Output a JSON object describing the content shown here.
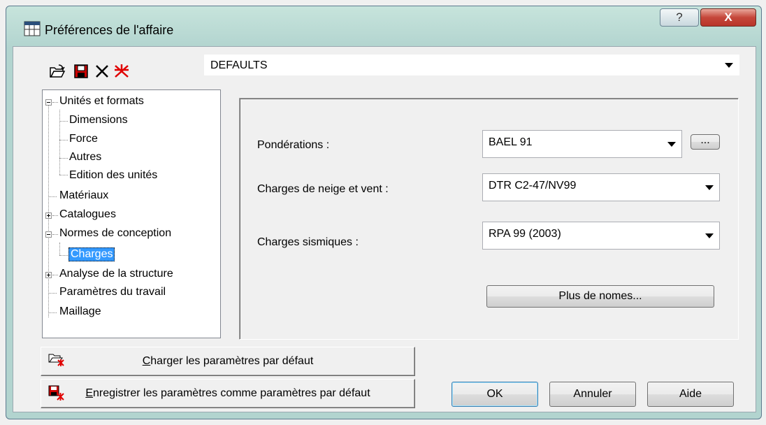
{
  "window": {
    "title": "Préférences de l'affaire",
    "help_glyph": "?",
    "close_glyph": "X"
  },
  "toolbar": {
    "icons": [
      "open-folder-icon",
      "save-icon",
      "delete-icon",
      "new-icon"
    ],
    "preset_value": "DEFAULTS"
  },
  "tree": {
    "units": "Unités et formats",
    "dimensions": "Dimensions",
    "force": "Force",
    "others": "Autres",
    "units_edit": "Edition des unités",
    "materials": "Matériaux",
    "catalogs": "Catalogues",
    "design_codes": "Normes de conception",
    "loads": "Charges",
    "structure_analysis": "Analyse de la structure",
    "job_params": "Paramètres du travail",
    "meshing": "Maillage",
    "selected": "Charges"
  },
  "panel": {
    "ponderations_label": "Pondérations :",
    "ponderations_value": "BAEL 91",
    "browse_label": "...",
    "snow_wind_label": "Charges de neige et vent :",
    "snow_wind_value": "DTR C2-47/NV99",
    "seismic_label": "Charges sismiques :",
    "seismic_value": "RPA 99 (2003)",
    "more_norms_label": "Plus de nomes..."
  },
  "bottom": {
    "load_defaults_prefix": "C",
    "load_defaults_rest": "harger les paramètres par défaut",
    "save_defaults_prefix": "E",
    "save_defaults_rest": "nregistrer les paramètres comme paramètres par défaut",
    "ok": "OK",
    "cancel": "Annuler",
    "help": "Aide"
  },
  "colors": {
    "selection": "#3399ff",
    "title_bar": "#b2d4cf",
    "close_button": "#c5473a"
  }
}
